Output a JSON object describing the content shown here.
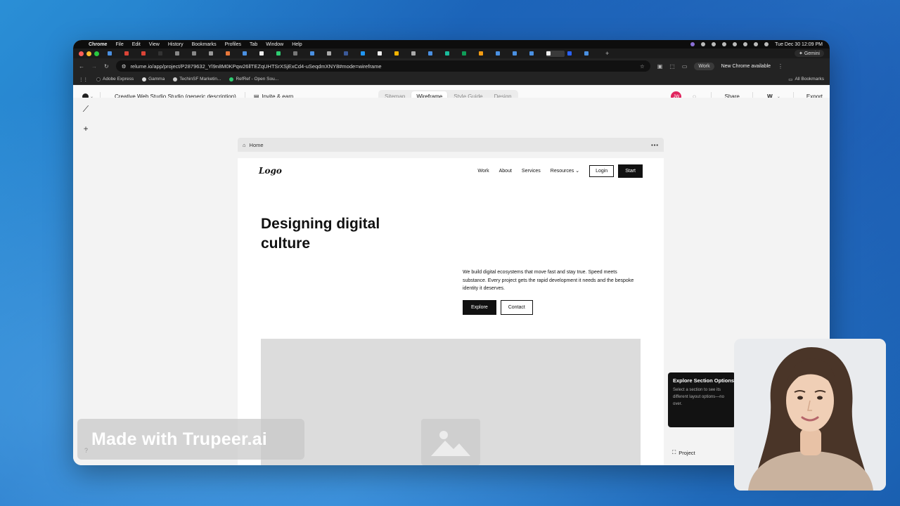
{
  "menubar": {
    "app": "Chrome",
    "items": [
      "File",
      "Edit",
      "View",
      "History",
      "Bookmarks",
      "Profiles",
      "Tab",
      "Window",
      "Help"
    ],
    "clock": "Tue Dec 30  12:09 PM"
  },
  "tabs": {
    "count_visible": 30,
    "gemini_label": "Gemini",
    "new_tab_icon": "plus-icon"
  },
  "address_bar": {
    "url": "relume.io/app/project/P2879632_Yl9n8M0KPqw26llTEZqUHTSrXSjExCd4-uSeqdmXNY8#mode=wireframe",
    "work_label": "Work",
    "update_label": "New Chrome available"
  },
  "bookmarks": {
    "items": [
      "Adobe Express",
      "Gamma",
      "TechinSF Marketin...",
      "RefRef - Open Sou..."
    ],
    "all_label": "All Bookmarks"
  },
  "app_toolbar": {
    "project_name": "Creative Web Studio Studio (generic description)",
    "invite_label": "Invite & earn",
    "modes": [
      "Sitemap",
      "Wireframe",
      "Style Guide",
      "Design"
    ],
    "active_mode": "Wireframe",
    "avatar_initials": "JW",
    "share_label": "Share",
    "export_label": "Export"
  },
  "frame": {
    "page_name": "Home"
  },
  "site": {
    "logo": "Logo",
    "nav": [
      "Work",
      "About",
      "Services",
      "Resources"
    ],
    "login": "Login",
    "start": "Start",
    "hero_title": "Designing digital culture",
    "hero_desc": "We build digital ecosystems that move fast and stay true. Speed meets substance. Every project gets the rapid development it needs and the bespoke identity it deserves.",
    "explore": "Explore",
    "contact": "Contact"
  },
  "tooltip": {
    "title": "Explore Section Options",
    "body": "Select a section to see its different layout options—no over."
  },
  "project_panel": {
    "label": "Project"
  },
  "watermark": "Made with Trupeer.ai",
  "colors": {
    "accent": "#111111",
    "avatar": "#e0245e",
    "desktop": "#2a8fd6"
  }
}
